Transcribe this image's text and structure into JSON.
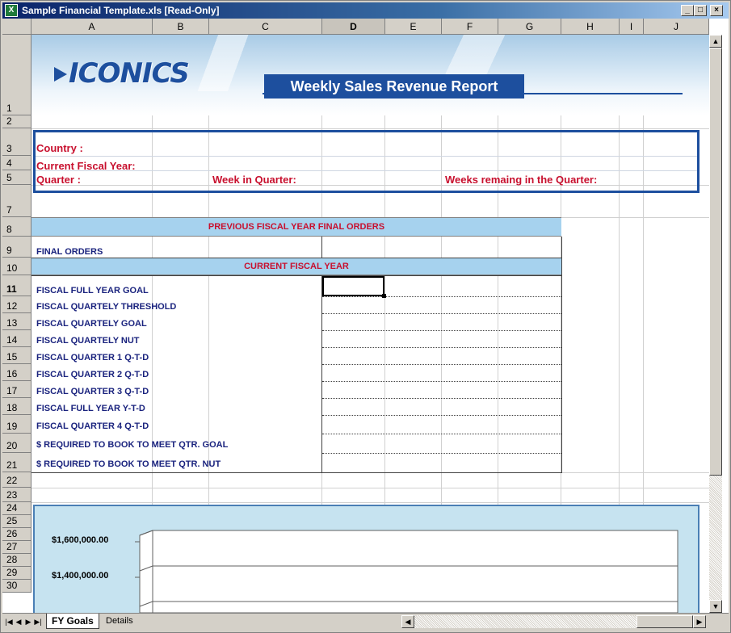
{
  "window": {
    "title": "Sample Financial Template.xls  [Read-Only]",
    "icon": "excel-icon",
    "controls": [
      "minimize-icon",
      "restore-icon",
      "close-icon"
    ]
  },
  "columns": [
    "A",
    "B",
    "C",
    "D",
    "E",
    "F",
    "G",
    "H",
    "I",
    "J"
  ],
  "selected_column": "D",
  "rows": [
    "1",
    "2",
    "3",
    "4",
    "5",
    "7",
    "8",
    "9",
    "10",
    "11",
    "12",
    "13",
    "14",
    "15",
    "16",
    "17",
    "18",
    "19",
    "20",
    "21",
    "22",
    "23",
    "24",
    "25",
    "26",
    "27",
    "28",
    "29",
    "30"
  ],
  "selected_row": "11",
  "banner": {
    "logo": "ICONICS",
    "title": "Weekly Sales Revenue Report"
  },
  "header_info": {
    "country_label": "Country :",
    "fiscal_year_label": "Current Fiscal Year:",
    "quarter_label": "Quarter :",
    "week_label": "Week in Quarter:",
    "weeks_remaining_label": "Weeks remaing in the Quarter:"
  },
  "sections": {
    "previous": "PREVIOUS FISCAL YEAR FINAL ORDERS",
    "current": "CURRENT  FISCAL  YEAR"
  },
  "final_orders_label": "FINAL ORDERS",
  "metrics": [
    "FISCAL  FULL YEAR GOAL",
    "FISCAL QUARTELY THRESHOLD",
    "FISCAL QUARTELY GOAL",
    "FISCAL QUARTELY NUT",
    "FISCAL QUARTER 1  Q-T-D",
    "FISCAL QUARTER 2  Q-T-D",
    "FISCAL QUARTER 3  Q-T-D",
    "FISCAL FULL YEAR Y-T-D",
    "FISCAL QUARTER 4 Q-T-D",
    "$ REQUIRED TO BOOK TO MEET QTR. GOAL",
    "$ REQUIRED TO BOOK TO MEET QTR. NUT"
  ],
  "chart_data": {
    "type": "bar",
    "title": "",
    "xlabel": "",
    "ylabel": "",
    "ytick_labels": [
      "$1,600,000.00",
      "$1,400,000.00"
    ],
    "categories": [],
    "values": []
  },
  "sheet_tabs": [
    {
      "label": "FY Goals",
      "active": true
    },
    {
      "label": "Details",
      "active": false
    }
  ],
  "colors": {
    "title_bar": "#0a246a",
    "section_header": "#a6d2ee",
    "label_red": "#c8102e",
    "label_navy": "#1a237e",
    "banner_blue": "#1d4f9e"
  }
}
